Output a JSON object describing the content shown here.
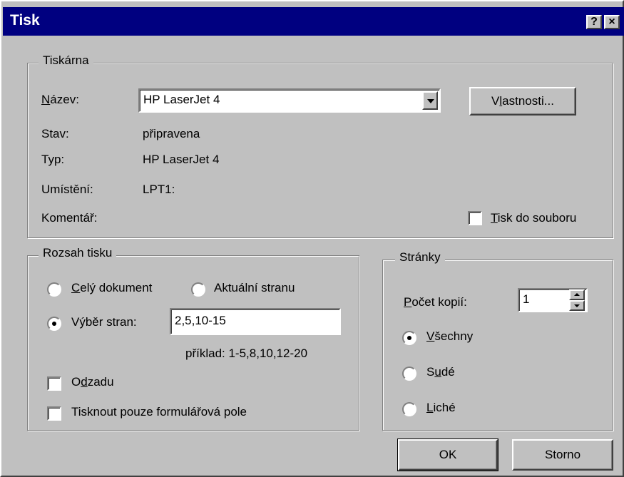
{
  "window": {
    "title": "Tisk",
    "help_label": "?",
    "close_label": "×"
  },
  "printer": {
    "group_label": "Tiskárna",
    "name_label_accel": "N",
    "name_label_rest": "ázev:",
    "name_value": "HP LaserJet 4",
    "properties_pre": "V",
    "properties_accel": "l",
    "properties_post": "astnosti...",
    "status_label": "Stav:",
    "status_value": "připravena",
    "type_label": "Typ:",
    "type_value": "HP LaserJet 4",
    "location_label": "Umístění:",
    "location_value": "LPT1:",
    "comment_label": "Komentář:",
    "print_to_file_accel": "T",
    "print_to_file_rest": "isk do souboru",
    "print_to_file_checked": false
  },
  "range": {
    "group_label": "Rozsah tisku",
    "whole_doc_accel": "C",
    "whole_doc_rest": "elý dokument",
    "current_page": "Aktuální stranu",
    "selection_label": "Výběr stran:",
    "selection_value": "2,5,10-15",
    "example": "příklad: 1-5,8,10,12-20",
    "reverse_pre": "O",
    "reverse_accel": "d",
    "reverse_post": "zadu",
    "forms_only": "Tisknout pouze formulářová pole",
    "selected": "selection"
  },
  "pages": {
    "group_label": "Stránky",
    "copies_accel": "P",
    "copies_rest": "očet kopií:",
    "copies_value": "1",
    "all_accel": "V",
    "all_rest": "šechny",
    "even_pre": "S",
    "even_accel": "u",
    "even_post": "dé",
    "odd_accel": "L",
    "odd_rest": "iché",
    "selected": "all"
  },
  "buttons": {
    "ok": "OK",
    "cancel": "Storno"
  }
}
